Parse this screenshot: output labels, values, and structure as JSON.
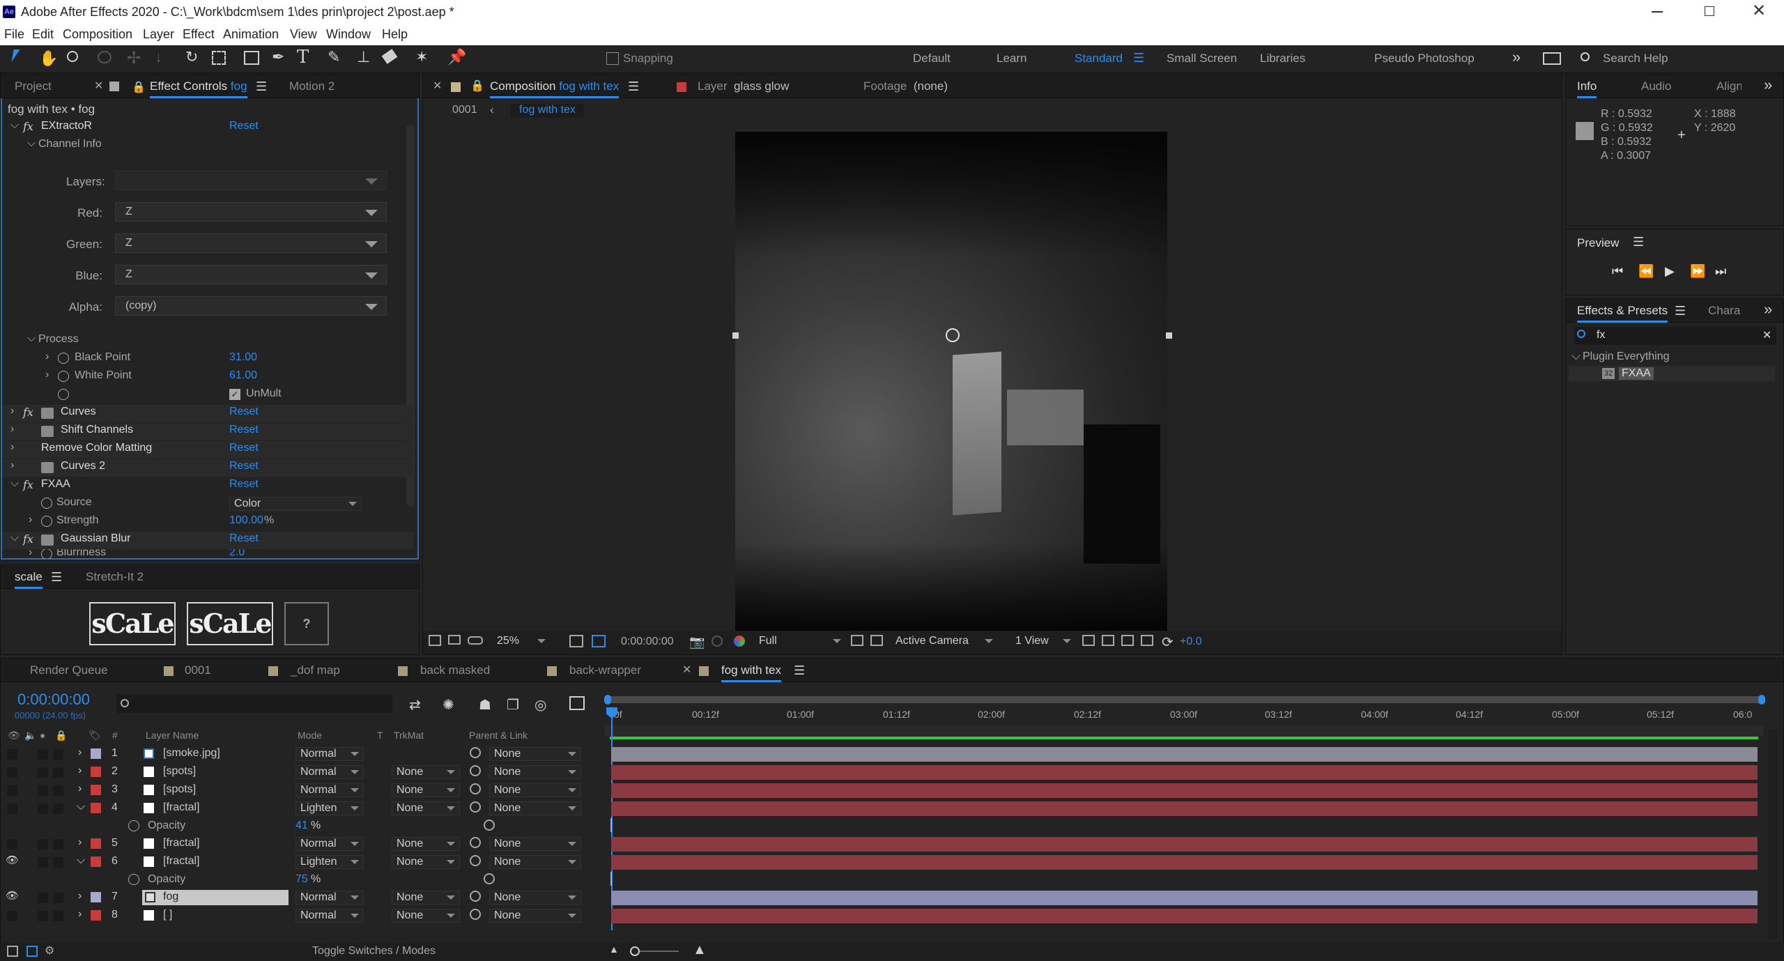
{
  "window": {
    "title": "Adobe After Effects 2020 - C:\\_Work\\bdcm\\sem 1\\des prin\\project 2\\post.aep *",
    "app_icon": "Ae"
  },
  "menu": [
    "File",
    "Edit",
    "Composition",
    "Layer",
    "Effect",
    "Animation",
    "View",
    "Window",
    "Help"
  ],
  "toolbar": {
    "snapping": "Snapping",
    "workspaces": [
      "Default",
      "Learn",
      "Standard",
      "Small Screen",
      "Libraries",
      "Pseudo Photoshop"
    ],
    "search_placeholder": "Search Help"
  },
  "left_tabs": {
    "project": "Project",
    "effect_controls": "Effect Controls",
    "effect_controls_layer": "fog",
    "motion": "Motion 2"
  },
  "effect_controls": {
    "breadcrumb": "fog with tex • fog",
    "extractor": {
      "name": "EXtractoR",
      "reset": "Reset",
      "channel_info": "Channel Info",
      "fields": [
        {
          "label": "Layers:",
          "value": ""
        },
        {
          "label": "Red:",
          "value": "Z"
        },
        {
          "label": "Green:",
          "value": "Z"
        },
        {
          "label": "Blue:",
          "value": "Z"
        },
        {
          "label": "Alpha:",
          "value": "(copy)"
        }
      ],
      "process": "Process",
      "black_point_label": "Black Point",
      "black_point": "31.00",
      "white_point_label": "White Point",
      "white_point": "61.00",
      "unmult": "UnMult"
    },
    "effects": [
      {
        "name": "Curves",
        "reset": "Reset"
      },
      {
        "name": "Shift Channels",
        "reset": "Reset"
      },
      {
        "name": "Remove Color Matting",
        "reset": "Reset"
      },
      {
        "name": "Curves 2",
        "reset": "Reset"
      }
    ],
    "fxaa": {
      "name": "FXAA",
      "reset": "Reset",
      "source_label": "Source",
      "source_value": "Color",
      "strength_label": "Strength",
      "strength_value": "100.00",
      "strength_unit": "%"
    },
    "gaussian": {
      "name": "Gaussian Blur",
      "reset": "Reset",
      "blurriness_label": "Blurriness",
      "blurriness_value": "2.0"
    }
  },
  "scale_panel": {
    "tab": "scale",
    "tab2": "Stretch-It 2",
    "btn1": "sCaLe",
    "btn2": "sCaLe",
    "btn3": "?"
  },
  "composition": {
    "tab_label": "Composition",
    "comp_name": "fog with tex",
    "layer_tab_label": "Layer",
    "layer_tab_name": "glass glow",
    "footage_label": "Footage",
    "footage_value": "(none)",
    "crumb_1": "0001",
    "crumb_2": "fog with tex",
    "zoom": "25%",
    "timecode": "0:00:00:00",
    "resolution": "Full",
    "camera": "Active Camera",
    "views": "1 View",
    "exposure": "+0.0"
  },
  "info_panel": {
    "tabs": [
      "Info",
      "Audio",
      "Align"
    ],
    "r": "R : 0.5932",
    "g": "G : 0.5932",
    "b": "B : 0.5932",
    "a": "A : 0.3007",
    "x": "X : 1888",
    "y": "Y : 2620",
    "swatch": "#979797"
  },
  "preview": {
    "title": "Preview"
  },
  "effects_presets": {
    "tab": "Effects & Presets",
    "tab2": "Chara",
    "search": "fx",
    "group": "Plugin Everything",
    "item_badge": "32",
    "item": "FXAA"
  },
  "timeline": {
    "tabs": [
      "Render Queue",
      "0001",
      "_dof map",
      "back masked",
      "back-wrapper",
      "fog with tex"
    ],
    "tab_colors": [
      "#a89a7a",
      "#a89a7a",
      "#a89a7a",
      "#a89a7a",
      "#a89a7a"
    ],
    "timecode": "0:00:00:00",
    "fps": "00000 (24.00 fps)",
    "columns": {
      "num": "#",
      "layer_name": "Layer Name",
      "mode": "Mode",
      "t": "T",
      "trkmat": "TrkMat",
      "parent": "Parent & Link"
    },
    "ruler": [
      "0f",
      "00:12f",
      "01:00f",
      "01:12f",
      "02:00f",
      "02:12f",
      "03:00f",
      "03:12f",
      "04:00f",
      "04:12f",
      "05:00f",
      "05:12f",
      "06:0"
    ],
    "layers": [
      {
        "num": "1",
        "name": "[smoke.jpg]",
        "mode": "Normal",
        "trkmat": "",
        "parent": "None",
        "color": "#a8a8c8",
        "bar": "#8a8a98"
      },
      {
        "num": "2",
        "name": "[spots]",
        "mode": "Normal",
        "trkmat": "None",
        "parent": "None",
        "color": "#c83c3c",
        "bar": "#8c3a42"
      },
      {
        "num": "3",
        "name": "[spots]",
        "mode": "Normal",
        "trkmat": "None",
        "parent": "None",
        "color": "#c83c3c",
        "bar": "#8c3a42"
      },
      {
        "num": "4",
        "name": "[fractal]",
        "mode": "Lighten",
        "trkmat": "None",
        "parent": "None",
        "color": "#c83c3c",
        "bar": "#8c3a42"
      },
      {
        "num": "5",
        "name": "[fractal]",
        "mode": "Normal",
        "trkmat": "None",
        "parent": "None",
        "color": "#c83c3c",
        "bar": "#8c3a42"
      },
      {
        "num": "6",
        "name": "[fractal]",
        "mode": "Lighten",
        "trkmat": "None",
        "parent": "None",
        "color": "#c83c3c",
        "bar": "#8c3a42"
      },
      {
        "num": "7",
        "name": "fog",
        "mode": "Normal",
        "trkmat": "None",
        "parent": "None",
        "color": "#a8a8c8",
        "bar": "#8c8cb0"
      },
      {
        "num": "8",
        "name": "[ ]",
        "mode": "Normal",
        "trkmat": "None",
        "parent": "None",
        "color": "#c83c3c",
        "bar": "#8c3a42"
      }
    ],
    "opacity_label": "Opacity",
    "opacity_4": "41",
    "opacity_6": "75",
    "pct": "%",
    "toggle": "Toggle Switches / Modes"
  }
}
